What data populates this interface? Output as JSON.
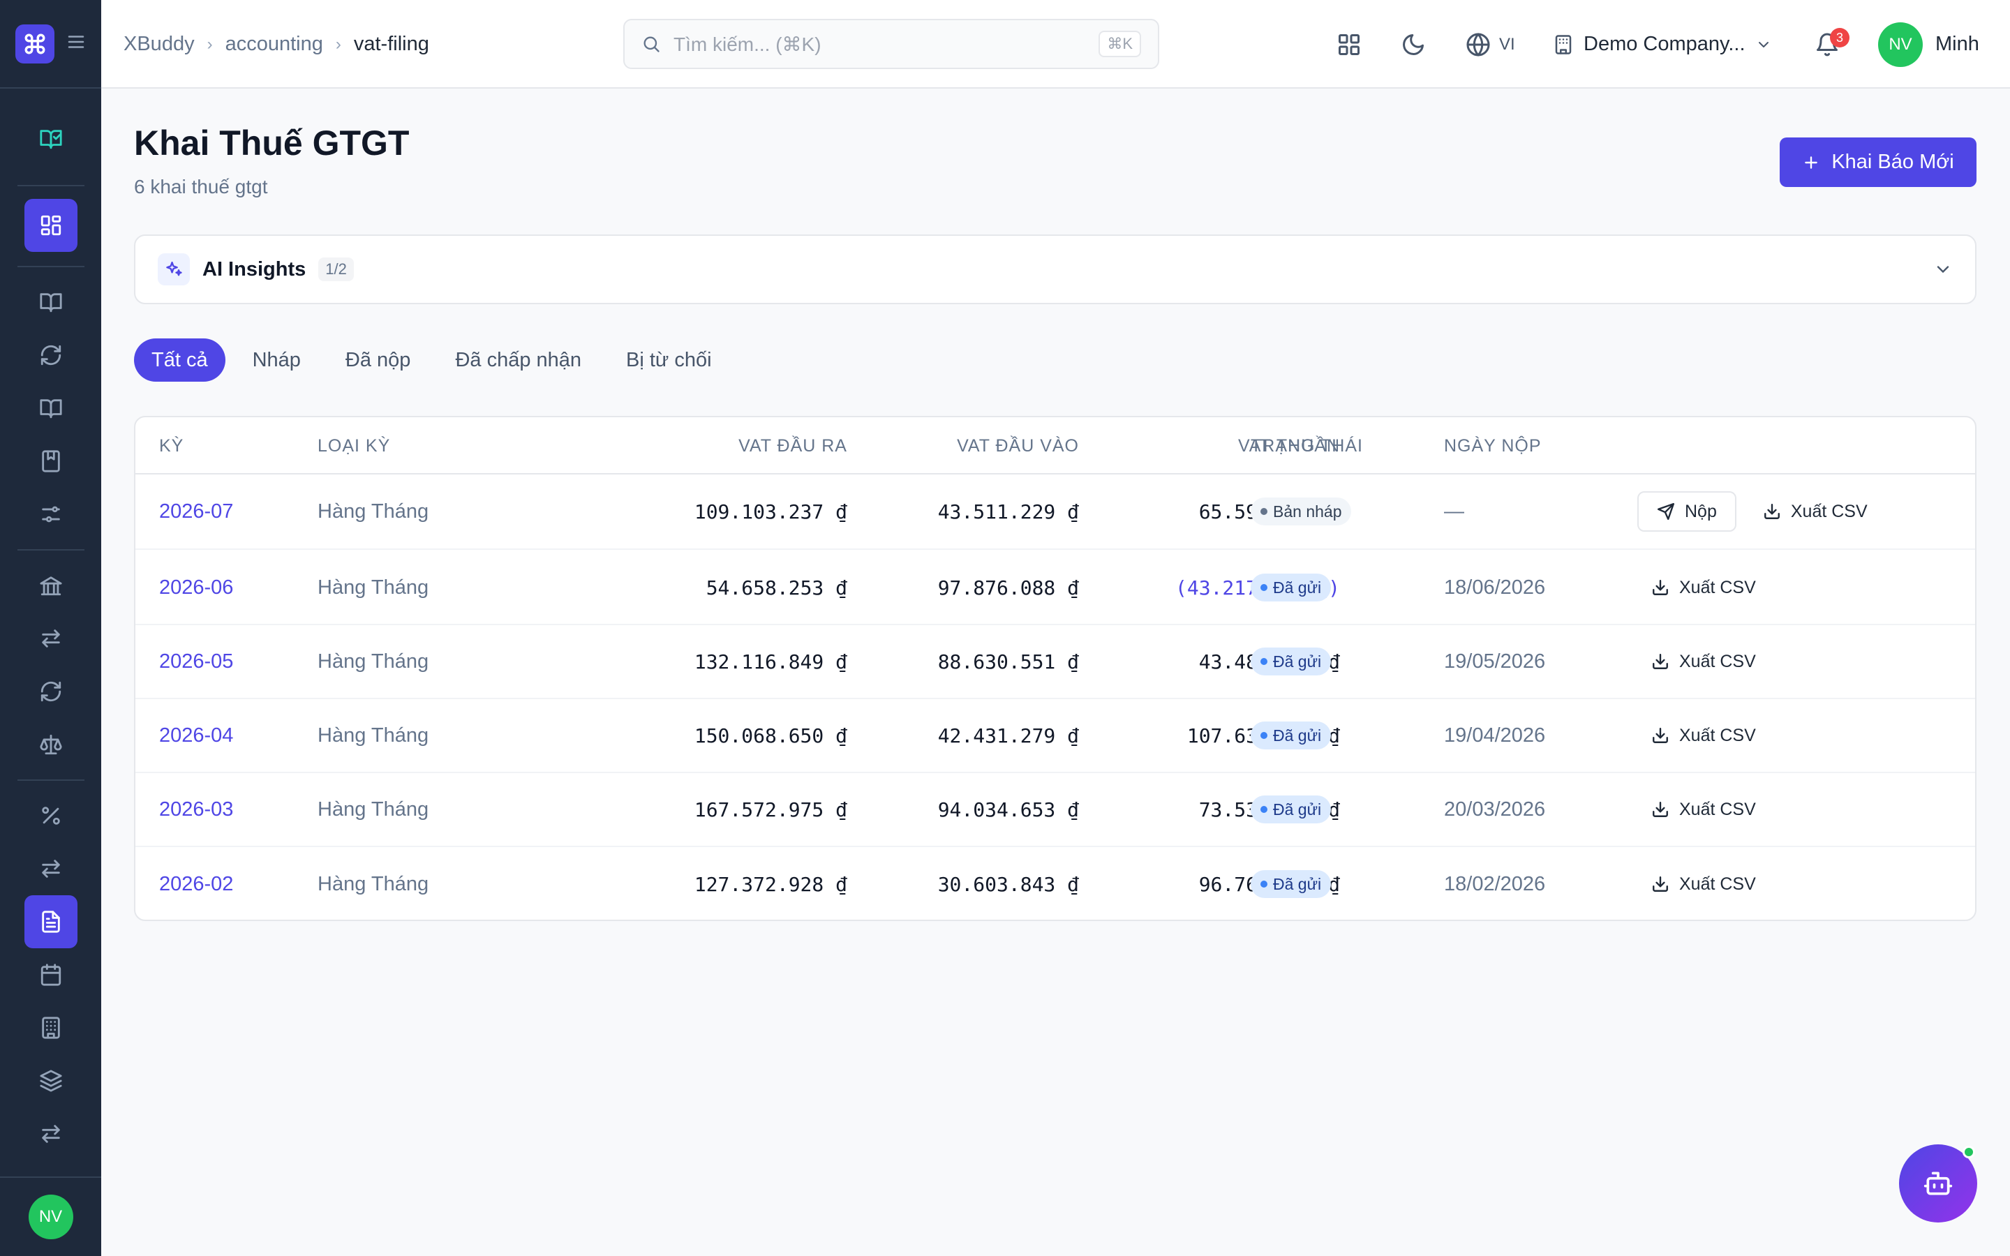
{
  "breadcrumb": {
    "root": "XBuddy",
    "section": "accounting",
    "current": "vat-filing"
  },
  "search": {
    "placeholder": "Tìm kiếm... (⌘K)",
    "shortcut": "⌘K"
  },
  "topbar": {
    "language": "VI",
    "company": "Demo Company...",
    "notifications": "3",
    "user_initials": "NV",
    "user_name": "Minh"
  },
  "sidebar": {
    "user_initials": "NV"
  },
  "page": {
    "title": "Khai Thuế GTGT",
    "subtitle": "6 khai thuế gtgt",
    "new_button": "Khai Báo Mới"
  },
  "insights": {
    "title": "AI Insights",
    "count": "1/2"
  },
  "tabs": [
    "Tất cả",
    "Nháp",
    "Đã nộp",
    "Đã chấp nhận",
    "Bị từ chối"
  ],
  "table": {
    "headers": [
      "KỲ",
      "LOẠI KỲ",
      "VAT ĐẦU RA",
      "VAT ĐẦU VÀO",
      "VAT THUẦN",
      "TRẠNG THÁI",
      "NGÀY NỘP"
    ],
    "submit_label": "Nộp",
    "export_label": "Xuất CSV",
    "rows": [
      {
        "period": "2026-07",
        "type": "Hàng Tháng",
        "vat_out": "109.103.237 ₫",
        "vat_in": "43.511.229 ₫",
        "vat_net": "65.592.008 ₫",
        "status": "Bản nháp",
        "date": "—"
      },
      {
        "period": "2026-06",
        "type": "Hàng Tháng",
        "vat_out": "54.658.253 ₫",
        "vat_in": "97.876.088 ₫",
        "vat_net": "(43.217.835 ₫)",
        "status": "Đã gửi",
        "date": "18/06/2026"
      },
      {
        "period": "2026-05",
        "type": "Hàng Tháng",
        "vat_out": "132.116.849 ₫",
        "vat_in": "88.630.551 ₫",
        "vat_net": "43.486.298 ₫",
        "status": "Đã gửi",
        "date": "19/05/2026"
      },
      {
        "period": "2026-04",
        "type": "Hàng Tháng",
        "vat_out": "150.068.650 ₫",
        "vat_in": "42.431.279 ₫",
        "vat_net": "107.637.371 ₫",
        "status": "Đã gửi",
        "date": "19/04/2026"
      },
      {
        "period": "2026-03",
        "type": "Hàng Tháng",
        "vat_out": "167.572.975 ₫",
        "vat_in": "94.034.653 ₫",
        "vat_net": "73.538.322 ₫",
        "status": "Đã gửi",
        "date": "20/03/2026"
      },
      {
        "period": "2026-02",
        "type": "Hàng Tháng",
        "vat_out": "127.372.928 ₫",
        "vat_in": "30.603.843 ₫",
        "vat_net": "96.769.085 ₫",
        "status": "Đã gửi",
        "date": "18/02/2026"
      }
    ]
  },
  "colors": {
    "accent": "#4f46e5",
    "sidebar": "#1e293b",
    "success": "#22c55e",
    "danger": "#ef4444"
  }
}
